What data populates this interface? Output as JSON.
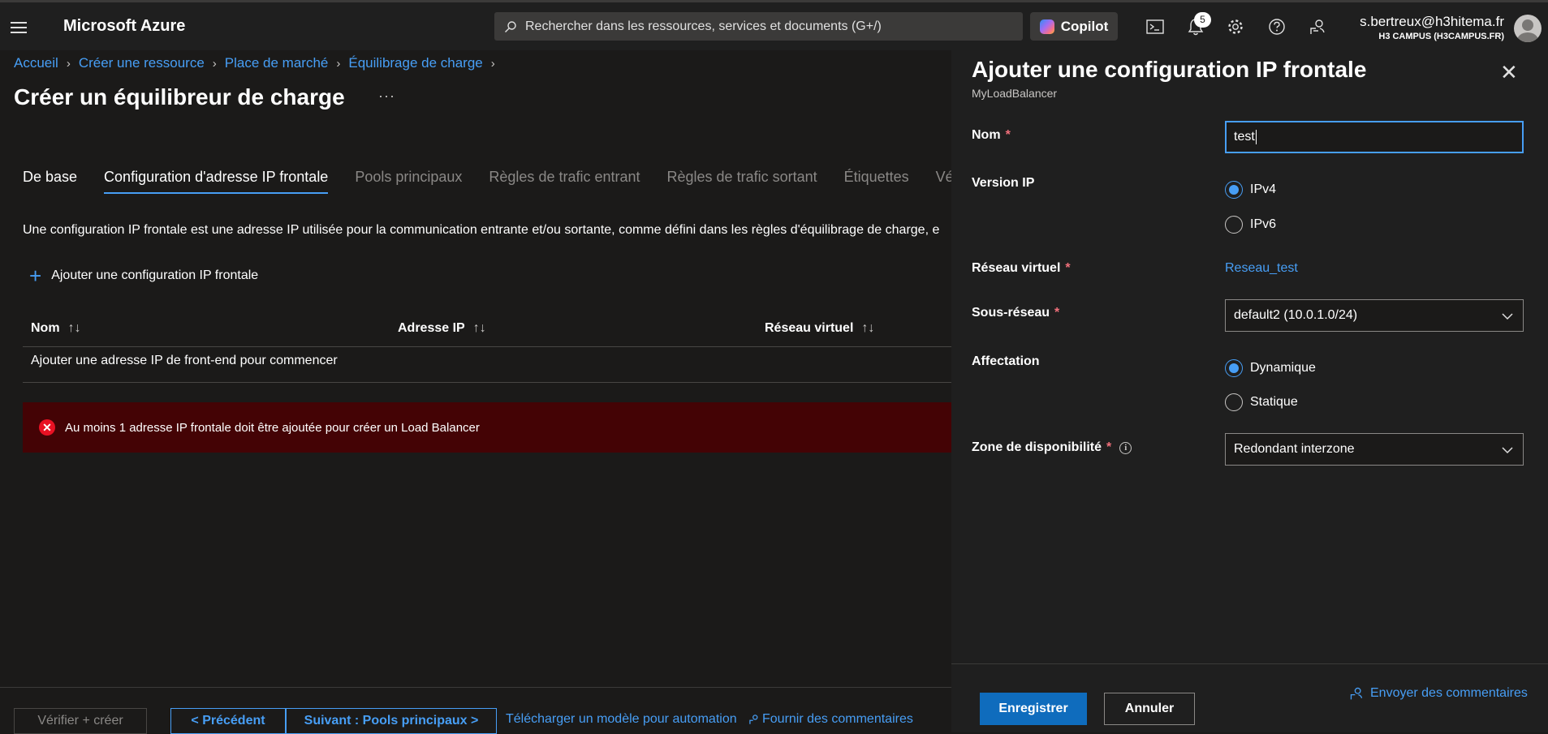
{
  "topbar": {
    "brand": "Microsoft Azure",
    "search_placeholder": "Rechercher dans les ressources, services et documents (G+/)",
    "copilot_label": "Copilot",
    "notification_count": "5",
    "user_email": "s.bertreux@h3hitema.fr",
    "user_tenant": "H3 CAMPUS (H3CAMPUS.FR)"
  },
  "breadcrumb": [
    "Accueil",
    "Créer une ressource",
    "Place de marché",
    "Équilibrage de charge"
  ],
  "page": {
    "title": "Créer un équilibreur de charge",
    "more": "···"
  },
  "tabs": [
    {
      "label": "De base",
      "state": "done"
    },
    {
      "label": "Configuration d'adresse IP frontale",
      "state": "active"
    },
    {
      "label": "Pools principaux",
      "state": "inactive"
    },
    {
      "label": "Règles de trafic entrant",
      "state": "inactive"
    },
    {
      "label": "Règles de trafic sortant",
      "state": "inactive"
    },
    {
      "label": "Étiquettes",
      "state": "inactive"
    },
    {
      "label": "Vérifie",
      "state": "inactive"
    }
  ],
  "main": {
    "description": "Une configuration IP frontale est une adresse IP utilisée pour la communication entrante et/ou sortante, comme défini dans les règles d'équilibrage de charge, e",
    "add_button": "Ajouter une configuration IP frontale",
    "columns": [
      "Nom",
      "Adresse IP",
      "Réseau virtuel"
    ],
    "sort_glyph": "↑↓",
    "empty_text": "Ajouter une adresse IP de front-end pour commencer",
    "error_message": "Au moins 1 adresse IP frontale doit être ajoutée pour créer un Load Balancer"
  },
  "footer": {
    "review_create": "Vérifier + créer",
    "previous": "< Précédent",
    "next": "Suivant : Pools principaux >",
    "download_template": "Télécharger un modèle pour automation",
    "feedback": "Fournir des commentaires"
  },
  "panel": {
    "title": "Ajouter une configuration IP frontale",
    "subtitle": "MyLoadBalancer",
    "fields": {
      "name_label": "Nom",
      "name_value": "test",
      "ip_version_label": "Version IP",
      "ipv4": "IPv4",
      "ipv6": "IPv6",
      "ip_version_selected": "IPv4",
      "vnet_label": "Réseau virtuel",
      "vnet_value": "Reseau_test",
      "subnet_label": "Sous-réseau",
      "subnet_value": "default2 (10.0.1.0/24)",
      "assignment_label": "Affectation",
      "dynamic": "Dynamique",
      "static": "Statique",
      "assignment_selected": "Dynamique",
      "zone_label": "Zone de disponibilité",
      "zone_value": "Redondant interzone",
      "required_mark": "*",
      "info_glyph": "i"
    },
    "save": "Enregistrer",
    "cancel": "Annuler",
    "feedback": "Envoyer des commentaires"
  },
  "colors": {
    "accent": "#479ef5",
    "primary_button": "#0f6cbd",
    "error_bg": "#440305",
    "error_icon": "#e81123",
    "required": "#f1707b"
  }
}
